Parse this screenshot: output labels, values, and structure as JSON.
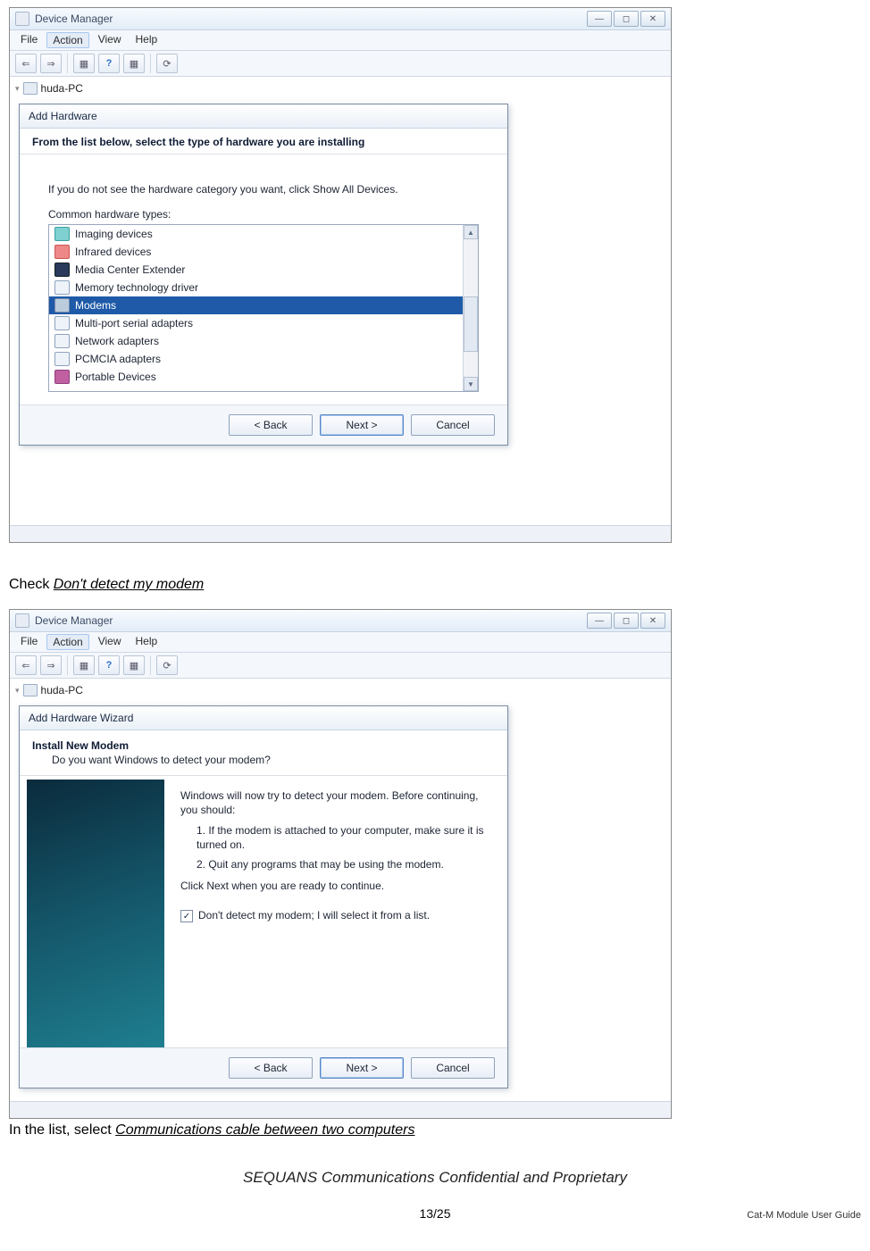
{
  "instr1_prefix": "Check ",
  "instr1_em": "Don't detect my modem",
  "instr2_prefix": "In the list, select ",
  "instr2_em": "Communications cable between two computers",
  "footer": "SEQUANS Communications Confidential and Proprietary",
  "pagenum": "13/25",
  "sidenote": "Cat-M Module User Guide",
  "win": {
    "title": "Device Manager",
    "menu": {
      "file": "File",
      "action": "Action",
      "view": "View",
      "help": "Help"
    },
    "tree_root": "huda-PC"
  },
  "dlg1": {
    "title": "Add Hardware",
    "heading": "From the list below, select the type of hardware you are installing",
    "hint": "If you do not see the hardware category you want, click Show All Devices.",
    "sub": "Common hardware types:",
    "items": {
      "i0": "Imaging devices",
      "i1": "Infrared devices",
      "i2": "Media Center Extender",
      "i3": "Memory technology driver",
      "i4": "Modems",
      "i5": "Multi-port serial adapters",
      "i6": "Network adapters",
      "i7": "PCMCIA adapters",
      "i8": "Portable Devices"
    },
    "btns": {
      "back": "< Back",
      "next": "Next >",
      "cancel": "Cancel"
    }
  },
  "dlg2": {
    "title": "Add Hardware Wizard",
    "head_t1": "Install New Modem",
    "head_t2": "Do you want Windows to detect your modem?",
    "para1": "Windows will now try to detect your modem.  Before continuing, you should:",
    "ol1": "1.  If the modem is attached to your computer, make sure it is turned on.",
    "ol2": "2.  Quit any programs that may be using the modem.",
    "para2": "Click Next when you are ready to continue.",
    "cb_label": "Don't detect my modem; I will select it from a list.",
    "btns": {
      "back": "< Back",
      "next": "Next >",
      "cancel": "Cancel"
    }
  }
}
